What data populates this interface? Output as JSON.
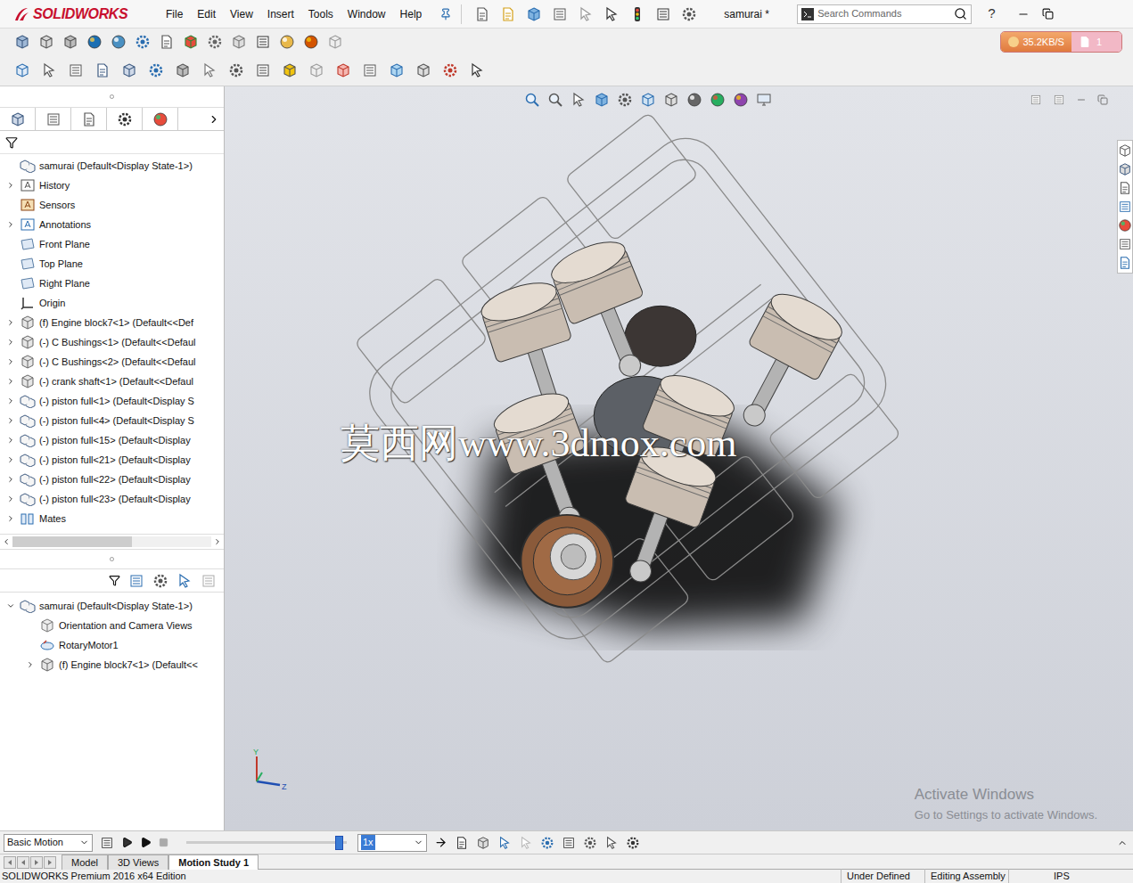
{
  "app": {
    "brand": "SOLIDWORKS",
    "document": "samurai *"
  },
  "menu": [
    "File",
    "Edit",
    "View",
    "Insert",
    "Tools",
    "Window",
    "Help"
  ],
  "search": {
    "placeholder": "Search Commands"
  },
  "help_button": "?",
  "network_badge": {
    "speed": "35.2KB/S",
    "count": "1"
  },
  "feature_tree": {
    "root": "samurai  (Default<Display State-1>)",
    "items": [
      {
        "label": "History",
        "expandable": true,
        "kind": "history"
      },
      {
        "label": "Sensors",
        "expandable": false,
        "kind": "sensor"
      },
      {
        "label": "Annotations",
        "expandable": true,
        "kind": "annotation"
      },
      {
        "label": "Front Plane",
        "expandable": false,
        "kind": "plane"
      },
      {
        "label": "Top Plane",
        "expandable": false,
        "kind": "plane"
      },
      {
        "label": "Right Plane",
        "expandable": false,
        "kind": "plane"
      },
      {
        "label": "Origin",
        "expandable": false,
        "kind": "origin"
      },
      {
        "label": "(f) Engine block7<1> (Default<<Def",
        "expandable": true,
        "kind": "part"
      },
      {
        "label": "(-) C Bushings<1> (Default<<Defaul",
        "expandable": true,
        "kind": "part"
      },
      {
        "label": "(-) C Bushings<2> (Default<<Defaul",
        "expandable": true,
        "kind": "part"
      },
      {
        "label": "(-) crank shaft<1> (Default<<Defaul",
        "expandable": true,
        "kind": "part"
      },
      {
        "label": "(-) piston full<1> (Default<Display S",
        "expandable": true,
        "kind": "assembly"
      },
      {
        "label": "(-) piston full<4> (Default<Display S",
        "expandable": true,
        "kind": "assembly"
      },
      {
        "label": "(-) piston full<15> (Default<Display",
        "expandable": true,
        "kind": "assembly"
      },
      {
        "label": "(-) piston full<21> (Default<Display",
        "expandable": true,
        "kind": "assembly"
      },
      {
        "label": "(-) piston full<22> (Default<Display",
        "expandable": true,
        "kind": "assembly"
      },
      {
        "label": "(-) piston full<23> (Default<Display",
        "expandable": true,
        "kind": "assembly"
      },
      {
        "label": "Mates",
        "expandable": true,
        "kind": "mates"
      }
    ],
    "scroll": {
      "level": 0.6
    }
  },
  "motion_tree": {
    "root": "samurai  (Default<Display State-1>)",
    "root_expanded": true,
    "items": [
      {
        "label": "Orientation and Camera Views",
        "expandable": false,
        "kind": "camera"
      },
      {
        "label": "RotaryMotor1",
        "expandable": false,
        "kind": "motor"
      },
      {
        "label": "(f) Engine block7<1> (Default<<",
        "expandable": true,
        "kind": "part"
      }
    ]
  },
  "viewport": {
    "watermark": "莫西网www.3dmox.com",
    "activation": {
      "title": "Activate Windows",
      "hint": "Go to Settings to activate Windows."
    },
    "triad": {
      "up": "Y",
      "right": "Z"
    }
  },
  "motion_toolbar": {
    "study_type": "Basic Motion",
    "speed": "1x",
    "timeline": {
      "level": 0.98
    }
  },
  "tabs": [
    {
      "label": "Model",
      "selected": false
    },
    {
      "label": "3D Views",
      "selected": false
    },
    {
      "label": "Motion Study 1",
      "selected": true
    }
  ],
  "status_bar": {
    "edition": "SOLIDWORKS Premium 2016 x64 Edition",
    "fields": [
      "Under Defined",
      "Editing Assembly",
      "IPS"
    ]
  }
}
